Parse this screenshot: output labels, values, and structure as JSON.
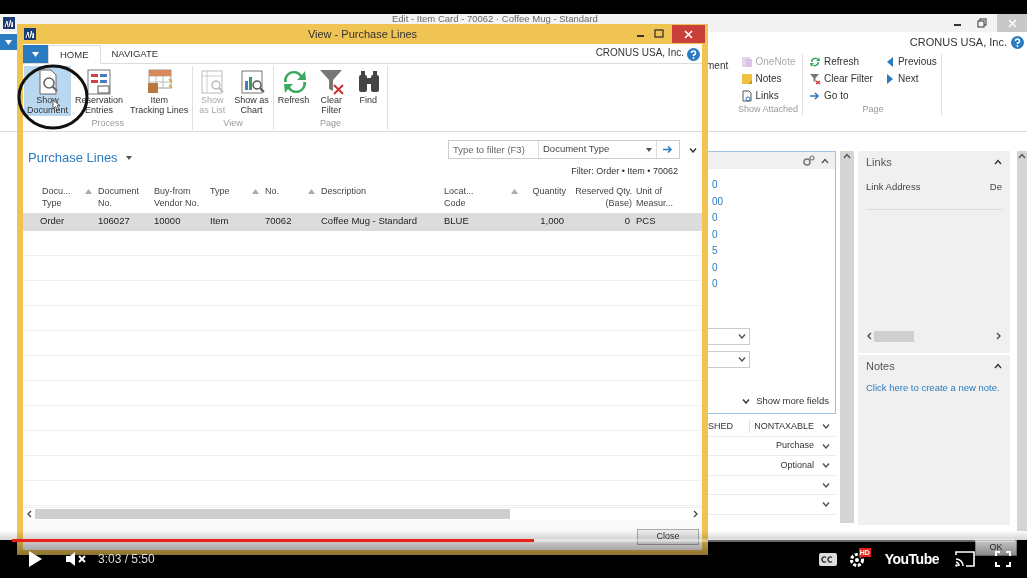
{
  "background_window": {
    "title": "Edit - Item Card - 70062 · Coffee Mug - Standard",
    "company": "CRONUS USA, Inc.",
    "ribbon_cut_text": "ment",
    "ribbon_groups": [
      {
        "label": "Show Attached",
        "columns": [
          [
            {
              "label": "OneNote",
              "disabled": true
            },
            {
              "label": "Notes",
              "disabled": false
            },
            {
              "label": "Links",
              "disabled": false
            }
          ]
        ]
      },
      {
        "label": "Page",
        "columns": [
          [
            {
              "label": "Refresh",
              "disabled": false
            },
            {
              "label": "Clear Filter",
              "disabled": false
            },
            {
              "label": "Go to",
              "disabled": false
            }
          ],
          [
            {
              "label": "Previous",
              "disabled": false
            },
            {
              "label": "Next",
              "disabled": false
            }
          ]
        ]
      }
    ],
    "detail_values": [
      "0",
      "00",
      "0",
      "0",
      "5",
      "0",
      "0"
    ],
    "show_more_fields": "Show more fields",
    "field_rows": [
      {
        "left": "SHED",
        "value": "NONTAXABLE"
      },
      {
        "value": "Purchase"
      },
      {
        "value": "Optional"
      },
      {},
      {}
    ],
    "links": {
      "title": "Links",
      "column_1": "Link Address",
      "column_2": "De"
    },
    "notes": {
      "title": "Notes",
      "link": "Click here to create a new note."
    },
    "ok_button": "OK"
  },
  "dialog": {
    "title": "View - Purchase Lines",
    "tabs": [
      {
        "label": "HOME",
        "selected": true
      },
      {
        "label": "NAVIGATE",
        "selected": false
      }
    ],
    "company": "CRONUS USA, Inc.",
    "ribbon_groups": [
      {
        "label": "Process",
        "actions": [
          {
            "label": "Show\nDocument",
            "selected": true,
            "disabled": false
          },
          {
            "label": "Reservation\nEntries",
            "selected": false,
            "disabled": false
          },
          {
            "label": "Item\nTracking Lines",
            "selected": false,
            "disabled": false
          }
        ]
      },
      {
        "label": "View",
        "actions": [
          {
            "label": "Show\nas List",
            "selected": false,
            "disabled": true
          },
          {
            "label": "Show as\nChart",
            "selected": false,
            "disabled": false
          }
        ]
      },
      {
        "label": "Page",
        "actions": [
          {
            "label": "Refresh",
            "selected": false,
            "disabled": false
          },
          {
            "label": "Clear\nFilter",
            "selected": false,
            "disabled": false
          },
          {
            "label": "Find",
            "selected": false,
            "disabled": false
          }
        ]
      }
    ],
    "list": {
      "title": "Purchase Lines",
      "filter_placeholder": "Type to filter (F3)",
      "filter_field": "Document Type",
      "filter_summary": "Filter: Order • Item • 70062",
      "columns": [
        {
          "label": "Docu...\nType",
          "sorted": true
        },
        {
          "label": "Document\nNo.",
          "sorted": false
        },
        {
          "label": "Buy-from\nVendor No.",
          "sorted": false
        },
        {
          "label": "Type",
          "sorted": true
        },
        {
          "label": "No.",
          "sorted": true
        },
        {
          "label": "Description",
          "sorted": false
        },
        {
          "label": "Locat...\nCode",
          "sorted": true
        },
        {
          "label": "Quantity",
          "sorted": false
        },
        {
          "label": "Reserved Qty.\n(Base)",
          "sorted": false
        },
        {
          "label": "Unit of\nMeasur...",
          "sorted": false
        }
      ],
      "rows": [
        {
          "selected": true,
          "cells": [
            "Order",
            "106027",
            "10000",
            "Item",
            "70062",
            "Coffee Mug - Standard",
            "BLUE",
            "1,000",
            "0",
            "PCS"
          ]
        }
      ]
    },
    "close_button": "Close"
  },
  "player": {
    "progress": {
      "level": 0.52
    },
    "muted": true,
    "time": "3:03 / 5:50",
    "hd_badge": "HD",
    "logo": "YouTube"
  }
}
